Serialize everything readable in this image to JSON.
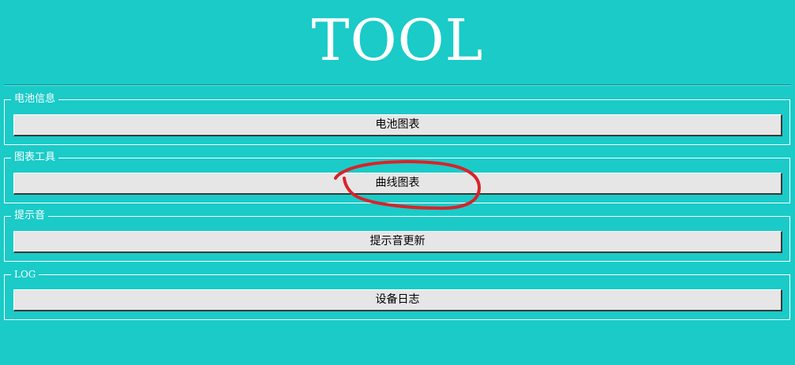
{
  "header": {
    "title": "TOOL"
  },
  "groups": [
    {
      "label": "电池信息",
      "button_label": "电池图表"
    },
    {
      "label": "图表工具",
      "button_label": "曲线图表"
    },
    {
      "label": "提示音",
      "button_label": "提示音更新"
    },
    {
      "label": "LOG",
      "button_label": "设备日志"
    }
  ],
  "colors": {
    "background": "#1acbc8",
    "button_face": "#e6e6e6",
    "annotation_stroke": "#d8232a"
  }
}
